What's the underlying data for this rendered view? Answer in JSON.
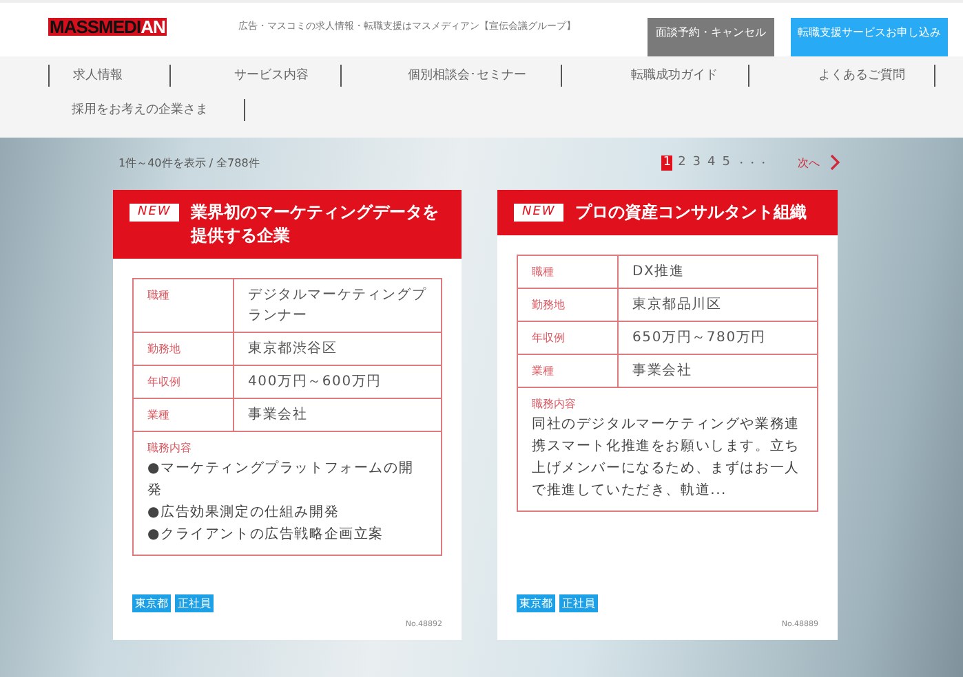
{
  "header": {
    "logo_main": "MASSMEDI",
    "logo_accent": "AN",
    "tagline": "広告・マスコミの求人情報・転職支援はマスメディアン【宣伝会議グループ】",
    "buttons": [
      {
        "label": "面談予約・キャンセル",
        "color": "#7a7a7a"
      },
      {
        "label": "転職支援サービスお申し込み",
        "color": "#29aaf4"
      }
    ]
  },
  "nav": {
    "items": [
      "求人情報",
      "サービス内容",
      "個別相談会･セミナー",
      "転職成功ガイド",
      "よくあるご質問",
      "採用をお考えの企業さま"
    ]
  },
  "result_count": "1件～40件を表示 / 全788件",
  "pagination": {
    "pages": [
      {
        "label": "1",
        "selected": true
      },
      {
        "label": "2",
        "selected": false
      },
      {
        "label": "3",
        "selected": false
      },
      {
        "label": "4",
        "selected": false
      },
      {
        "label": "5",
        "selected": false
      }
    ],
    "ellipsis": "・・・",
    "next": "次へ"
  },
  "jobs": [
    {
      "badge": "NEW",
      "title": "業界初のマーケティングデータを提供する企業",
      "fields": [
        {
          "label": "職種",
          "value": "デジタルマーケティングプランナー"
        },
        {
          "label": "勤務地",
          "value": "東京都渋谷区"
        },
        {
          "label": "年収例",
          "value": "400万円～600万円"
        },
        {
          "label": "業種",
          "value": "事業会社"
        }
      ],
      "description_label": "職務内容",
      "description": [
        "●マーケティングプラットフォームの開発",
        "●広告効果測定の仕組み開発",
        "●クライアントの広告戦略企画立案"
      ],
      "tags": [
        "東京都",
        "正社員"
      ],
      "number": "No.48892"
    },
    {
      "badge": "NEW",
      "title": "プロの資産コンサルタント組織",
      "fields": [
        {
          "label": "職種",
          "value": "DX推進"
        },
        {
          "label": "勤務地",
          "value": "東京都品川区"
        },
        {
          "label": "年収例",
          "value": "650万円～780万円"
        },
        {
          "label": "業種",
          "value": "事業会社"
        }
      ],
      "description_label": "職務内容",
      "description": [
        "同社のデジタルマーケティングや業務連携スマート化推進をお願いします。立ち上げメンバーになるため、まずはお一人で推進していただき、軌道..."
      ],
      "tags": [
        "東京都",
        "正社員"
      ],
      "number": "No.48889"
    }
  ]
}
